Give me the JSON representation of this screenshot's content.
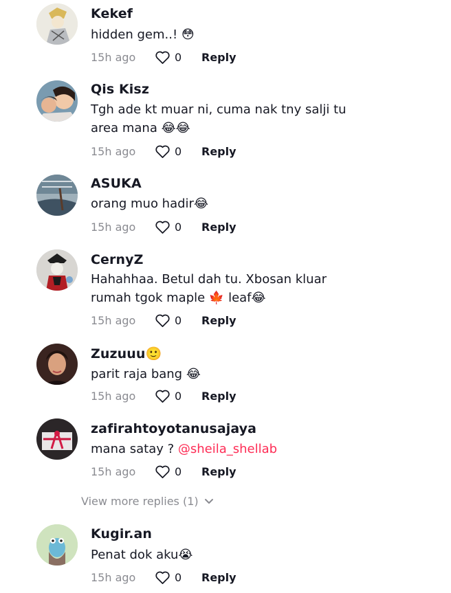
{
  "comments": [
    {
      "username": "Kekef",
      "text": "hidden gem..! 😳",
      "time": "15h ago",
      "likes": "0",
      "reply": "Reply"
    },
    {
      "username": "Qis Kisz",
      "text": "Tgh ade kt muar ni, cuma nak tny salji tu area mana 😂😂",
      "time": "15h ago",
      "likes": "0",
      "reply": "Reply"
    },
    {
      "username": "ASUKA",
      "text": "orang muo hadir😂",
      "time": "15h ago",
      "likes": "0",
      "reply": "Reply"
    },
    {
      "username": "CernyZ",
      "text": "Hahahhaa. Betul dah tu. Xbosan kluar rumah tgok maple 🍁 leaf😂",
      "time": "15h ago",
      "likes": "0",
      "reply": "Reply"
    },
    {
      "username": "Zuzuuu🙂",
      "text": "parit raja bang 😂",
      "time": "15h ago",
      "likes": "0",
      "reply": "Reply"
    },
    {
      "username": "zafirahtoyotanusajaya",
      "text": "mana satay ? ",
      "mention": "@sheila_shellab",
      "time": "15h ago",
      "likes": "0",
      "reply": "Reply"
    },
    {
      "username": "Kugir.an",
      "text": "Penat dok aku😭",
      "time": "15h ago",
      "likes": "0",
      "reply": "Reply"
    }
  ],
  "view_more": "View more replies (1)",
  "icons": {
    "like": "heart-outline-icon",
    "expand": "chevron-down-icon"
  },
  "colors": {
    "mention": "#fe2c55",
    "meta": "#8a8b91",
    "text": "#161823"
  }
}
